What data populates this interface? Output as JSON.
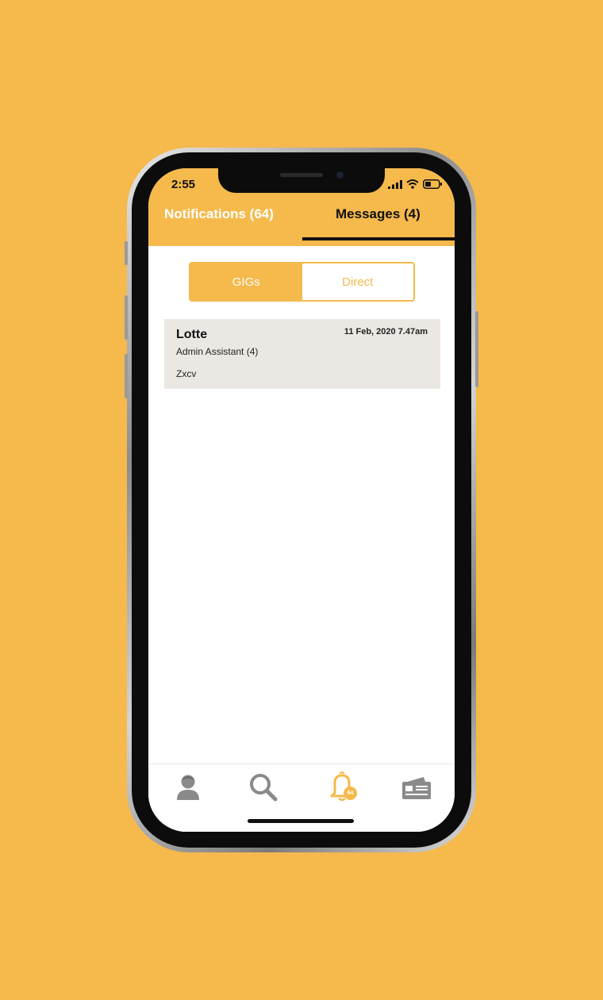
{
  "status_bar": {
    "time": "2:55",
    "icons": [
      "signal-icon",
      "wifi-icon",
      "battery-icon"
    ]
  },
  "header": {
    "tabs": [
      {
        "label": "Notifications (64)",
        "active": false
      },
      {
        "label": "Messages (4)",
        "active": true
      }
    ]
  },
  "segment": {
    "options": [
      {
        "label": "GIGs",
        "active": true
      },
      {
        "label": "Direct",
        "active": false
      }
    ]
  },
  "messages": [
    {
      "name": "Lotte",
      "date": "11 Feb, 2020 7.47am",
      "role": "Admin Assistant (4)",
      "preview": "Zxcv"
    }
  ],
  "bottom_nav": {
    "items": [
      {
        "icon": "profile-icon",
        "active": false
      },
      {
        "icon": "search-icon",
        "active": false
      },
      {
        "icon": "bell-icon",
        "active": true,
        "badge": "64"
      },
      {
        "icon": "wallet-icon",
        "active": false
      }
    ]
  },
  "colors": {
    "accent": "#F5B94C",
    "card_bg": "#EBE8E4",
    "icon_gray": "#8a8a8a"
  }
}
